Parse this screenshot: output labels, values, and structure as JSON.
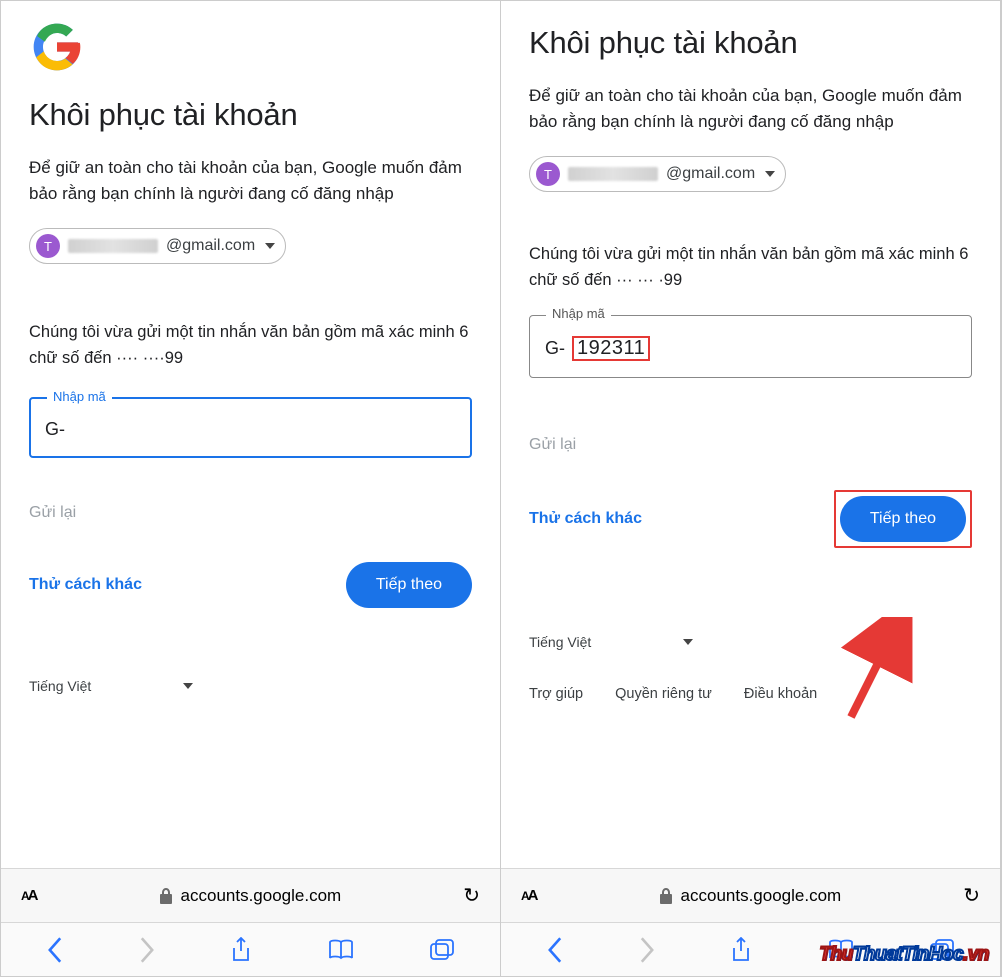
{
  "left": {
    "title": "Khôi phục tài khoản",
    "subtitle": "Để giữ an toàn cho tài khoản của bạn, Google muốn đảm bảo rằng bạn chính là người đang cố đăng nhập",
    "avatar_letter": "T",
    "email_suffix": "@gmail.com",
    "sent": "Chúng tôi vừa gửi một tin nhắn văn bản gồm mã xác minh 6 chữ số đến ···· ····99",
    "code_label": "Nhập mã",
    "code_prefix": "G-",
    "code_value": "",
    "resend": "Gửi lại",
    "try_other": "Thử cách khác",
    "next": "Tiếp theo",
    "language": "Tiếng Việt",
    "url_host": "accounts.google.com"
  },
  "right": {
    "title": "Khôi phục tài khoản",
    "subtitle": "Để giữ an toàn cho tài khoản của bạn, Google muốn đảm bảo rằng bạn chính là người đang cố đăng nhập",
    "avatar_letter": "T",
    "email_suffix": "@gmail.com",
    "sent": "Chúng tôi vừa gửi một tin nhắn văn bản gồm mã xác minh 6 chữ số đến ··· ··· ·99",
    "code_label": "Nhập mã",
    "code_prefix": "G-",
    "code_value": "192311",
    "resend": "Gửi lại",
    "try_other": "Thử cách khác",
    "next": "Tiếp theo",
    "language": "Tiếng Việt",
    "help": "Trợ giúp",
    "privacy": "Quyền riêng tư",
    "terms": "Điều khoản",
    "url_host": "accounts.google.com"
  },
  "watermark": "ThuThuatTinHoc.vn"
}
